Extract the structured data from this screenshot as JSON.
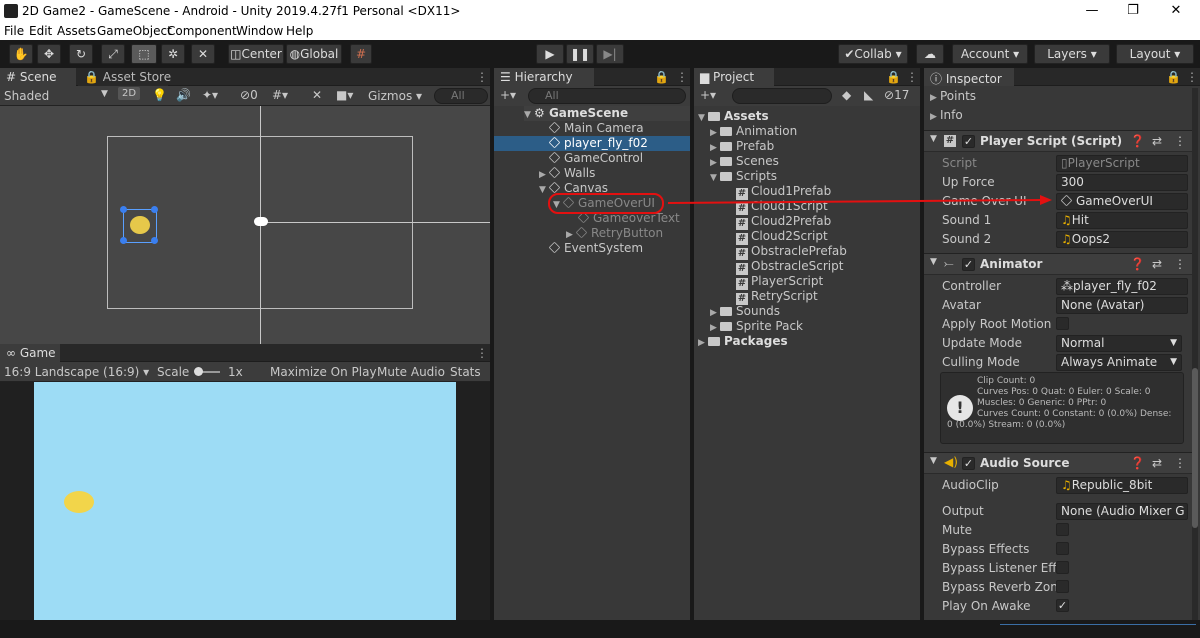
{
  "window": {
    "title": "2D Game2 - GameScene - Android - Unity 2019.4.27f1 Personal <DX11>",
    "minimize": "—",
    "maximize": "❐",
    "close": "✕"
  },
  "menu": [
    "File",
    "Edit",
    "Assets",
    "GameObject",
    "Component",
    "Window",
    "Help"
  ],
  "toolbar": {
    "pivot": "Center",
    "space": "Global",
    "collab": "Collab",
    "account": "Account",
    "layers": "Layers",
    "layout": "Layout"
  },
  "scene": {
    "tab": "Scene",
    "asset_store": "Asset Store",
    "shading": "Shaded",
    "mode2d": "2D",
    "hidden_count": "0",
    "gizmos": "Gizmos",
    "search_placeholder": "All"
  },
  "game": {
    "tab": "Game",
    "aspect": "16:9 Landscape (16:9)",
    "scale_label": "Scale",
    "scale_value": "1x",
    "maximize": "Maximize On Play",
    "mute": "Mute Audio",
    "stats": "Stats",
    "bg_color": "#9ddcf5"
  },
  "hierarchy": {
    "tab": "Hierarchy",
    "search_placeholder": "All",
    "scene": "GameScene",
    "items": [
      "Main Camera",
      "player_fly_f02",
      "GameControl",
      "Walls",
      "Canvas",
      "GameOverUI",
      "GameoverText",
      "RetryButton",
      "EventSystem"
    ]
  },
  "project": {
    "tab": "Project",
    "count": "17",
    "assets": "Assets",
    "folders": [
      "Animation",
      "Prefab",
      "Scenes",
      "Scripts",
      "Sounds",
      "Sprite Pack"
    ],
    "scripts": [
      "Cloud1Prefab",
      "Cloud1Script",
      "Cloud2Prefab",
      "Cloud2Script",
      "ObstraclePrefab",
      "ObstracleScript",
      "PlayerScript",
      "RetryScript"
    ],
    "packages": "Packages"
  },
  "inspector": {
    "tab": "Inspector",
    "points": "Points",
    "info": "Info",
    "player_script": {
      "title": "Player Script (Script)",
      "script_label": "Script",
      "script_value": "PlayerScript",
      "upforce_label": "Up Force",
      "upforce_value": "300",
      "gameover_label": "Game Over UI",
      "gameover_value": "GameOverUI",
      "sound1_label": "Sound 1",
      "sound1_value": "Hit",
      "sound2_label": "Sound 2",
      "sound2_value": "Oops2"
    },
    "animator": {
      "title": "Animator",
      "controller_label": "Controller",
      "controller_value": "player_fly_f02",
      "avatar_label": "Avatar",
      "avatar_value": "None (Avatar)",
      "root_motion_label": "Apply Root Motion",
      "update_label": "Update Mode",
      "update_value": "Normal",
      "culling_label": "Culling Mode",
      "culling_value": "Always Animate",
      "info_lines": [
        "Clip Count: 0",
        "Curves Pos: 0 Quat: 0 Euler: 0 Scale: 0",
        "Muscles: 0 Generic: 0 PPtr: 0",
        "Curves Count: 0 Constant: 0 (0.0%) Dense:",
        "0 (0.0%) Stream: 0 (0.0%)"
      ]
    },
    "audio": {
      "title": "Audio Source",
      "clip_label": "AudioClip",
      "clip_value": "Republic_8bit",
      "output_label": "Output",
      "output_value": "None (Audio Mixer G",
      "mute_label": "Mute",
      "bypass_effects_label": "Bypass Effects",
      "bypass_listener_label": "Bypass Listener Effe",
      "bypass_reverb_label": "Bypass Reverb Zone",
      "play_awake_label": "Play On Awake"
    }
  },
  "colors": {
    "annotation": "#e31010",
    "selection": "#2c5d87"
  }
}
